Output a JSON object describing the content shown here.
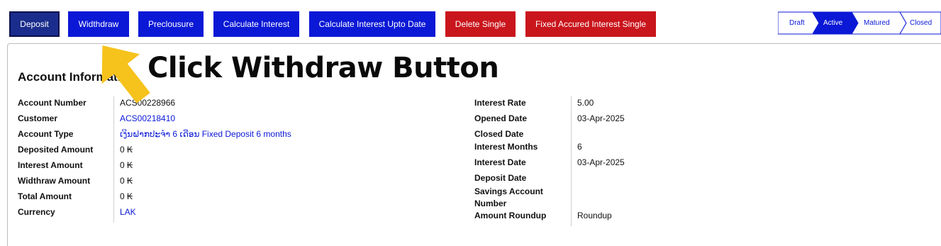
{
  "toolbar": {
    "deposit": "Deposit",
    "withdraw": "Widthdraw",
    "preclosure": "Preclousure",
    "calculate_interest": "Calculate Interest",
    "calculate_interest_upto": "Calculate Interest Upto Date",
    "delete_single": "Delete Single",
    "fixed_accrued": "Fixed Accured Interest Single"
  },
  "status_steps": [
    "Draft",
    "Active",
    "Matured",
    "Closed"
  ],
  "active_step": "Active",
  "section_title": "Account Information",
  "left_fields": [
    {
      "label": "Account Number",
      "value": "ACS00228966"
    },
    {
      "label": "Customer",
      "value": "ACS00218410"
    },
    {
      "label": "Account Type",
      "value": "ເງິນຝາກປະຈຳ 6 ເດືອນ Fixed Deposit 6 months"
    },
    {
      "label": "Deposited Amount",
      "value": "0 ₭"
    },
    {
      "label": "Interest Amount",
      "value": "0 ₭"
    },
    {
      "label": "Widthraw Amount",
      "value": "0 ₭"
    },
    {
      "label": "Total Amount",
      "value": "0 ₭"
    },
    {
      "label": "Currency",
      "value": "LAK"
    }
  ],
  "right_fields": [
    {
      "label": "Interest Rate",
      "value": "5.00"
    },
    {
      "label": "Opened Date",
      "value": "03-Apr-2025"
    },
    {
      "label": "Closed Date",
      "value": ""
    },
    {
      "label": "Interest Months",
      "value": "6"
    },
    {
      "label": "Interest Date",
      "value": "03-Apr-2025"
    },
    {
      "label": "Deposit Date",
      "value": ""
    },
    {
      "label": "Savings Account Number",
      "value": ""
    },
    {
      "label": "Amount Roundup",
      "value": "Roundup"
    }
  ],
  "annotation": {
    "text": "Click Withdraw Button",
    "arrow_color": "#f6c21c"
  },
  "colors": {
    "primary_blue": "#0b18d6",
    "deposit_navy": "#1a2d8c",
    "danger_red": "#c9151c"
  }
}
